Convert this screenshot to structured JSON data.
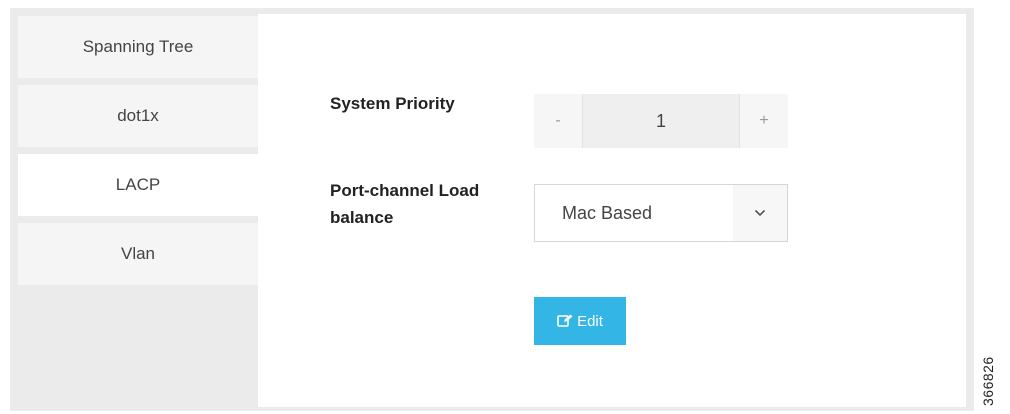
{
  "sidebar": {
    "items": [
      {
        "label": "Spanning Tree"
      },
      {
        "label": "dot1x"
      },
      {
        "label": "LACP",
        "active": true
      },
      {
        "label": "Vlan"
      }
    ]
  },
  "form": {
    "system_priority": {
      "label": "System Priority",
      "decrement": "-",
      "value": "1",
      "increment": "+"
    },
    "load_balance": {
      "label": "Port-channel Load balance",
      "selected": "Mac Based"
    },
    "edit_button": {
      "label": "Edit",
      "color": "#33b5e5"
    }
  },
  "figure_id": "366826"
}
